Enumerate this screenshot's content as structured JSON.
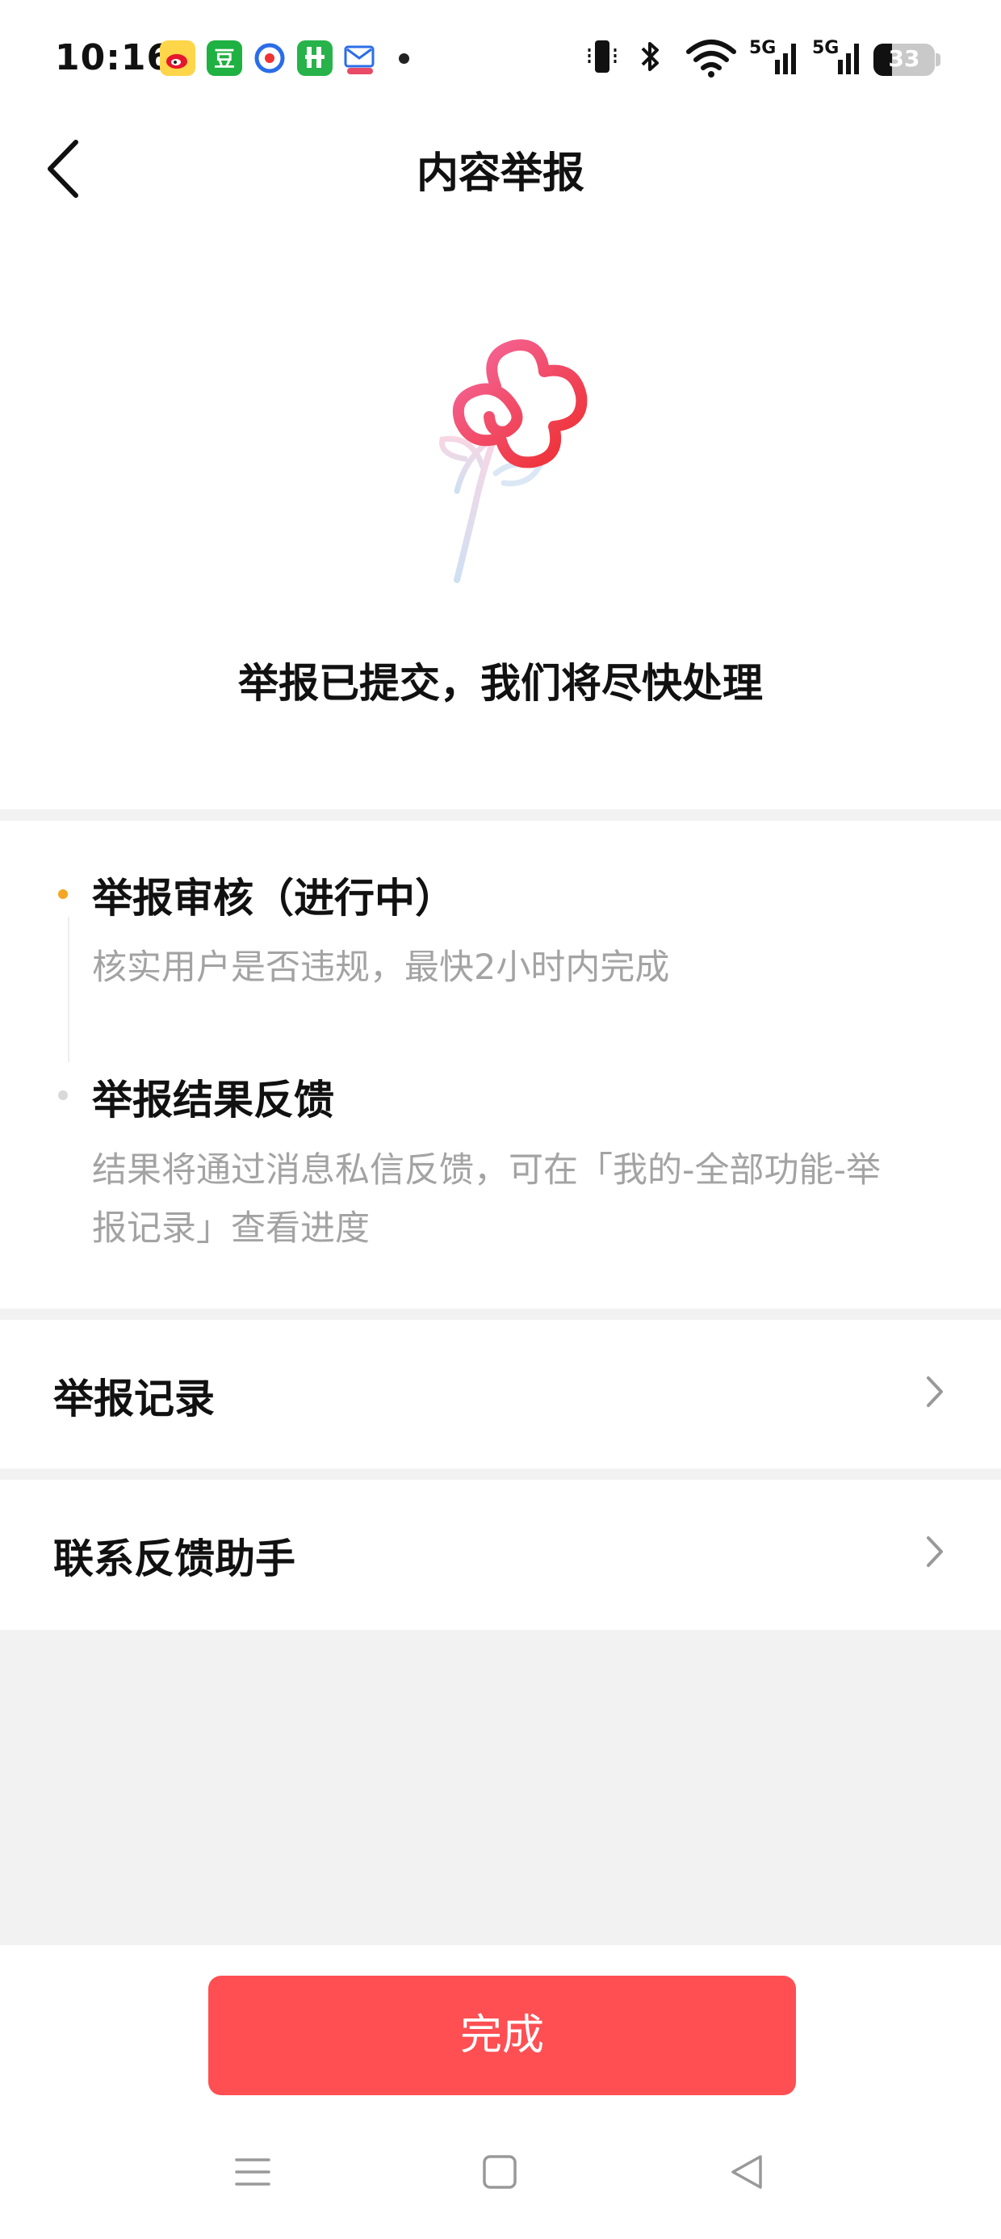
{
  "status_bar": {
    "time": "10:16",
    "notification_icons": [
      "weibo-icon",
      "douban-icon",
      "camera-app-icon",
      "green-app-icon",
      "mail-app-icon"
    ],
    "network": "5G",
    "battery": "33"
  },
  "header": {
    "title": "内容举报"
  },
  "hero": {
    "message": "举报已提交，我们将尽快处理"
  },
  "progress": {
    "steps": [
      {
        "title": "举报审核（进行中）",
        "lines": [
          "核实用户是否违规，最快2小时内完成"
        ],
        "state": "active"
      },
      {
        "title": "举报结果反馈",
        "lines": [
          "结果将通过消息私信反馈，可在「我的-全部功能-举",
          "报记录」查看进度"
        ],
        "state": "pending"
      }
    ]
  },
  "menu": {
    "items": [
      {
        "label": "举报记录"
      },
      {
        "label": "联系反馈助手"
      }
    ]
  },
  "footer": {
    "done_label": "完成"
  },
  "colors": {
    "accent": "#ff4f53",
    "active_dot": "#f5a623",
    "pending_dot": "#d9d9d9",
    "muted_text": "#a3a3a3",
    "separator": "#f2f2f2"
  }
}
